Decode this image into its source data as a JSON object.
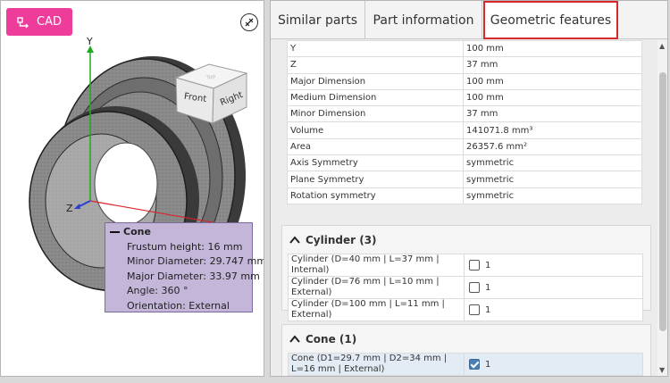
{
  "viewer": {
    "cad_button_label": "CAD",
    "axis_y": "Y",
    "axis_z": "Z",
    "cube_front": "Front",
    "cube_right": "Right",
    "cube_top": "Top",
    "popup": {
      "title": "Cone",
      "lines": [
        "Frustum height: 16 mm",
        "Minor Diameter: 29.747 mm",
        "Major Diameter: 33.97 mm",
        "Angle: 360 °",
        "Orientation: External"
      ]
    },
    "colors": {
      "cad_button": "#ee3c9a",
      "popup_bg": "#c3b6d8",
      "axis_y": "#1faa1f",
      "axis_x": "#d9232a",
      "axis_z": "#2a3fd0"
    }
  },
  "tabs": {
    "similar": "Similar parts",
    "info": "Part information",
    "geo": "Geometric features",
    "active": "Geometric features"
  },
  "properties": [
    {
      "key": "Y",
      "value": "100 mm"
    },
    {
      "key": "Z",
      "value": "37 mm"
    },
    {
      "key": "Major Dimension",
      "value": "100 mm"
    },
    {
      "key": "Medium Dimension",
      "value": "100 mm"
    },
    {
      "key": "Minor Dimension",
      "value": "37 mm"
    },
    {
      "key": "Volume",
      "value": "141071.8 mm³"
    },
    {
      "key": "Area",
      "value": "26357.6 mm²"
    },
    {
      "key": "Axis Symmetry",
      "value": "symmetric"
    },
    {
      "key": "Plane Symmetry",
      "value": "symmetric"
    },
    {
      "key": "Rotation symmetry",
      "value": "symmetric"
    }
  ],
  "cylinder": {
    "title": "Cylinder (3)",
    "rows": [
      {
        "label": "Cylinder (D=40 mm | L=37 mm | Internal)",
        "count": "1",
        "checked": false
      },
      {
        "label": "Cylinder (D=76 mm | L=10 mm | External)",
        "count": "1",
        "checked": false
      },
      {
        "label": "Cylinder (D=100 mm | L=11 mm | External)",
        "count": "1",
        "checked": false
      }
    ]
  },
  "cone": {
    "title": "Cone (1)",
    "rows": [
      {
        "label": "Cone (D1=29.7 mm | D2=34 mm | L=16 mm | External)",
        "count": "1",
        "checked": true
      }
    ]
  }
}
